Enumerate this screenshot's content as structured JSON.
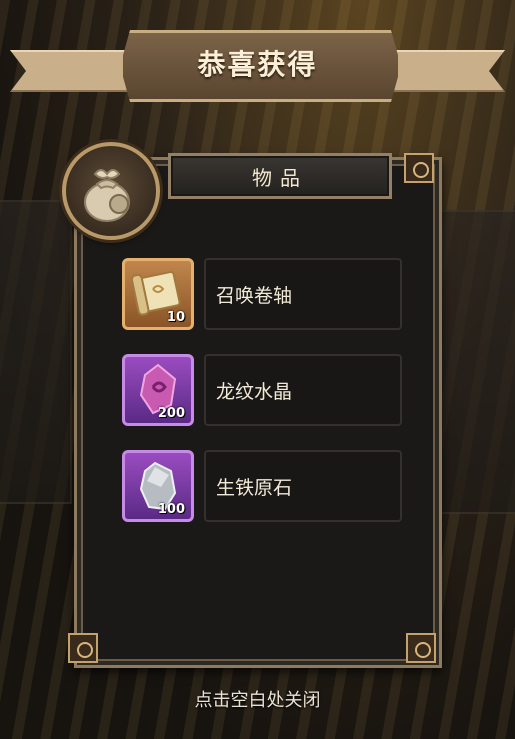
{
  "header": {
    "title": "恭喜获得"
  },
  "panel": {
    "category_label": "物品"
  },
  "items": [
    {
      "name": "召唤卷轴",
      "count": "10",
      "icon": "scroll-icon",
      "rarity_color": "#c0864d"
    },
    {
      "name": "龙纹水晶",
      "count": "200",
      "icon": "crystal-icon",
      "rarity_color": "#9a4cc0"
    },
    {
      "name": "生铁原石",
      "count": "100",
      "icon": "ore-icon",
      "rarity_color": "#9a4cc0"
    }
  ],
  "footer": {
    "hint": "点击空白处关闭"
  },
  "icons": {
    "category": "bag-icon"
  }
}
